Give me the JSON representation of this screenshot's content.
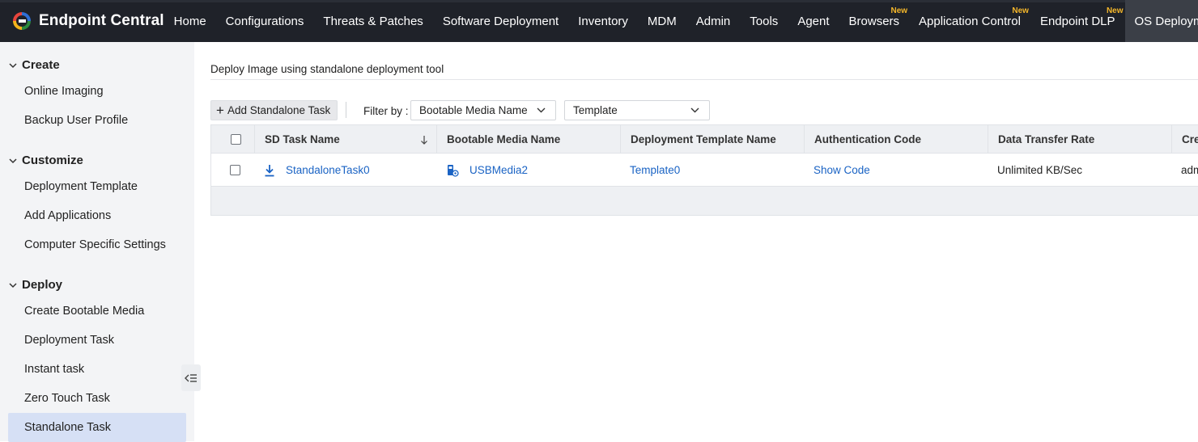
{
  "brand": {
    "name": "Endpoint Central"
  },
  "nav": [
    {
      "label": "Home",
      "badge": ""
    },
    {
      "label": "Configurations",
      "badge": ""
    },
    {
      "label": "Threats & Patches",
      "badge": ""
    },
    {
      "label": "Software Deployment",
      "badge": ""
    },
    {
      "label": "Inventory",
      "badge": ""
    },
    {
      "label": "MDM",
      "badge": ""
    },
    {
      "label": "Admin",
      "badge": ""
    },
    {
      "label": "Tools",
      "badge": ""
    },
    {
      "label": "Agent",
      "badge": ""
    },
    {
      "label": "Browsers",
      "badge": "New"
    },
    {
      "label": "Application Control",
      "badge": "New"
    },
    {
      "label": "Endpoint DLP",
      "badge": "New"
    },
    {
      "label": "OS Deployment",
      "badge": "",
      "active": true
    }
  ],
  "sidebar": {
    "sections": [
      {
        "title": "Create",
        "items": [
          "Online Imaging",
          "Backup User Profile"
        ]
      },
      {
        "title": "Customize",
        "items": [
          "Deployment Template",
          "Add Applications",
          "Computer Specific Settings"
        ]
      },
      {
        "title": "Deploy",
        "items": [
          "Create Bootable Media",
          "Deployment Task",
          "Instant task",
          "Zero Touch Task",
          "Standalone Task"
        ]
      }
    ],
    "active_item": "Standalone Task"
  },
  "main": {
    "title": "Deploy Image using standalone deployment tool",
    "toolbar": {
      "add_label": "Add Standalone Task",
      "filter_label": "Filter by :",
      "filter_media": "Bootable Media Name",
      "filter_template": "Template"
    },
    "table": {
      "columns": [
        "SD Task Name",
        "Bootable Media Name",
        "Deployment Template Name",
        "Authentication Code",
        "Data Transfer Rate",
        "Cre"
      ],
      "rows": [
        {
          "task": "StandaloneTask0",
          "media": "USBMedia2",
          "template": "Template0",
          "auth": "Show Code",
          "rate": "Unlimited KB/Sec",
          "created": "adm"
        }
      ]
    }
  },
  "colors": {
    "topbar": "#1f2229",
    "badge": "#f5b72a",
    "link": "#1a63c4",
    "active_side": "#d6e0f5"
  }
}
